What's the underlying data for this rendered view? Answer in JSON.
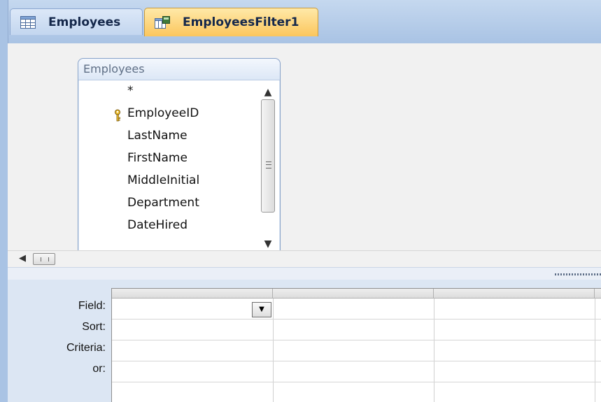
{
  "tabs": [
    {
      "label": "Employees",
      "icon": "table-icon",
      "active": false
    },
    {
      "label": "EmployeesFilter1",
      "icon": "query-icon",
      "active": true
    }
  ],
  "field_list": {
    "title": "Employees",
    "fields": [
      {
        "name": "*",
        "primary_key": false
      },
      {
        "name": "EmployeeID",
        "primary_key": true
      },
      {
        "name": "LastName",
        "primary_key": false
      },
      {
        "name": "FirstName",
        "primary_key": false
      },
      {
        "name": "MiddleInitial",
        "primary_key": false
      },
      {
        "name": "Department",
        "primary_key": false
      },
      {
        "name": "DateHired",
        "primary_key": false
      }
    ]
  },
  "grid": {
    "row_labels": {
      "field": "Field:",
      "sort": "Sort:",
      "criteria": "Criteria:",
      "or": "or:"
    }
  },
  "colors": {
    "active_tab": "#fbc65d",
    "tab_strip": "#a9c3e4",
    "grid_background": "#dce6f3"
  }
}
